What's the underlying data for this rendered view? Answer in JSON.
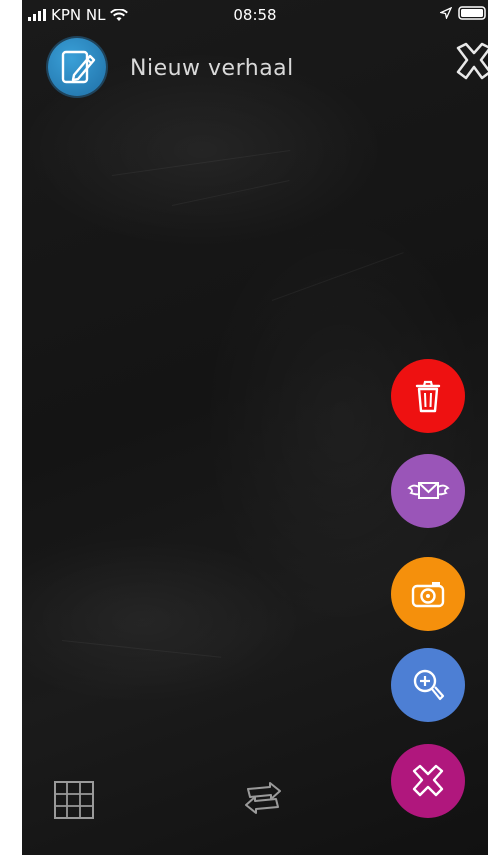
{
  "status_bar": {
    "carrier": "KPN NL",
    "time": "08:58",
    "signal_icon": "cellular-signal-icon",
    "wifi_icon": "wifi-icon",
    "location_icon": "location-arrow-icon",
    "battery_icon": "battery-icon"
  },
  "header": {
    "title": "Nieuw verhaal",
    "app_icon": "edit-note-icon",
    "close_icon": "close-x-icon"
  },
  "actions": [
    {
      "name": "delete",
      "icon": "trash-icon",
      "color": "#ee1111"
    },
    {
      "name": "send",
      "icon": "winged-envelope-icon",
      "color": "#9a55b8"
    },
    {
      "name": "camera",
      "icon": "camera-icon",
      "color": "#f5900c"
    },
    {
      "name": "zoom",
      "icon": "magnifier-plus-icon",
      "color": "#4d7fd4"
    },
    {
      "name": "cancel",
      "icon": "cancel-x-icon",
      "color": "#b0177d"
    }
  ],
  "bottom_toolbar": {
    "grid_icon": "grid-icon",
    "swap_icon": "swap-arrows-icon"
  },
  "colors": {
    "background": "#161616",
    "title_text": "#d9d9d9",
    "app_icon_blue": "#2a8ccc"
  }
}
